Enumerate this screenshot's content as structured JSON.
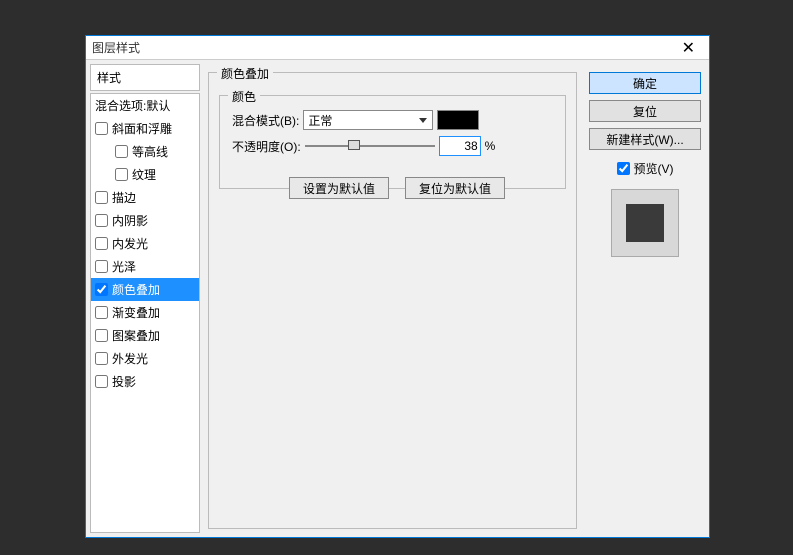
{
  "dialog": {
    "title": "图层样式"
  },
  "stylesHeader": "样式",
  "styleList": [
    {
      "label": "混合选项:默认",
      "checked": null,
      "indent": false,
      "selected": false
    },
    {
      "label": "斜面和浮雕",
      "checked": false,
      "indent": false,
      "selected": false
    },
    {
      "label": "等高线",
      "checked": false,
      "indent": true,
      "selected": false
    },
    {
      "label": "纹理",
      "checked": false,
      "indent": true,
      "selected": false
    },
    {
      "label": "描边",
      "checked": false,
      "indent": false,
      "selected": false
    },
    {
      "label": "内阴影",
      "checked": false,
      "indent": false,
      "selected": false
    },
    {
      "label": "内发光",
      "checked": false,
      "indent": false,
      "selected": false
    },
    {
      "label": "光泽",
      "checked": false,
      "indent": false,
      "selected": false
    },
    {
      "label": "颜色叠加",
      "checked": true,
      "indent": false,
      "selected": true
    },
    {
      "label": "渐变叠加",
      "checked": false,
      "indent": false,
      "selected": false
    },
    {
      "label": "图案叠加",
      "checked": false,
      "indent": false,
      "selected": false
    },
    {
      "label": "外发光",
      "checked": false,
      "indent": false,
      "selected": false
    },
    {
      "label": "投影",
      "checked": false,
      "indent": false,
      "selected": false
    }
  ],
  "group": {
    "outer": "颜色叠加",
    "inner": "颜色"
  },
  "fields": {
    "blendLabel": "混合模式(B):",
    "blendValue": "正常",
    "opacityLabel": "不透明度(O):",
    "opacityValue": "38",
    "opacityUnit": "%",
    "swatchColor": "#000000",
    "sliderPercent": 38
  },
  "midButtons": {
    "default": "设置为默认值",
    "reset": "复位为默认值"
  },
  "rightButtons": {
    "ok": "确定",
    "cancel": "复位",
    "newStyle": "新建样式(W)..."
  },
  "preview": {
    "label": "预览(V)",
    "checked": true
  }
}
